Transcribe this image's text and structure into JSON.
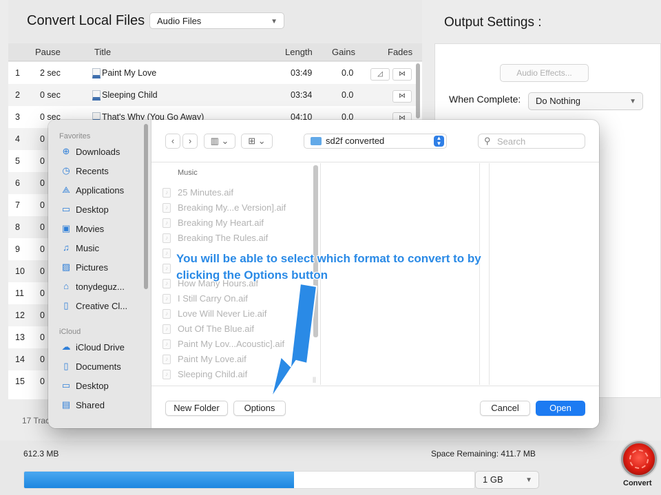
{
  "main": {
    "title": "Convert Local Files",
    "source_select": "Audio Files",
    "columns": {
      "pause": "Pause",
      "title": "Title",
      "length": "Length",
      "gains": "Gains",
      "fades": "Fades"
    },
    "tracks": [
      {
        "num": "1",
        "pause": "2 sec",
        "title": "Paint My Love",
        "length": "03:49",
        "gain": "0.0"
      },
      {
        "num": "2",
        "pause": "0 sec",
        "title": "Sleeping Child",
        "length": "03:34",
        "gain": "0.0"
      },
      {
        "num": "3",
        "pause": "0 sec",
        "title": "That's Why (You Go Away)",
        "length": "04:10",
        "gain": "0.0"
      },
      {
        "num": "4",
        "pause": "0"
      },
      {
        "num": "5",
        "pause": "0"
      },
      {
        "num": "6",
        "pause": "0"
      },
      {
        "num": "7",
        "pause": "0"
      },
      {
        "num": "8",
        "pause": "0"
      },
      {
        "num": "9",
        "pause": "0"
      },
      {
        "num": "10",
        "pause": "0"
      },
      {
        "num": "11",
        "pause": "0"
      },
      {
        "num": "12",
        "pause": "0"
      },
      {
        "num": "13",
        "pause": "0"
      },
      {
        "num": "14",
        "pause": "0"
      },
      {
        "num": "15",
        "pause": "0"
      }
    ],
    "track_count": "17 Trac"
  },
  "output": {
    "title": "Output Settings :",
    "audio_effects_button": "Audio Effects...",
    "when_complete_label": "When Complete:",
    "when_complete_value": "Do Nothing"
  },
  "status": {
    "total_size": "612.3 MB",
    "space_remaining": "Space Remaining: 411.7 MB",
    "capacity_select": "1 GB",
    "capacity_used_fraction": 0.6,
    "convert_label": "Convert"
  },
  "dialog": {
    "sidebar": {
      "favorites_header": "Favorites",
      "favorites": [
        {
          "label": "Downloads",
          "icon": "download-icon"
        },
        {
          "label": "Recents",
          "icon": "clock-icon"
        },
        {
          "label": "Applications",
          "icon": "applications-icon"
        },
        {
          "label": "Desktop",
          "icon": "desktop-icon"
        },
        {
          "label": "Movies",
          "icon": "film-icon"
        },
        {
          "label": "Music",
          "icon": "music-icon"
        },
        {
          "label": "Pictures",
          "icon": "pictures-icon"
        },
        {
          "label": "tonydeguz...",
          "icon": "home-icon"
        },
        {
          "label": "Creative Cl...",
          "icon": "document-icon"
        }
      ],
      "icloud_header": "iCloud",
      "icloud": [
        {
          "label": "iCloud Drive",
          "icon": "cloud-icon"
        },
        {
          "label": "Documents",
          "icon": "document-icon"
        },
        {
          "label": "Desktop",
          "icon": "desktop-icon"
        },
        {
          "label": "Shared",
          "icon": "shared-folder-icon"
        }
      ]
    },
    "location": "sd2f converted",
    "search_placeholder": "Search",
    "column_header": "Music",
    "files": [
      "25 Minutes.aif",
      "Breaking My...e Version].aif",
      "Breaking My Heart.aif",
      "Breaking The Rules.aif",
      "",
      "",
      "How Many Hours.aif",
      "I Still Carry On.aif",
      "Love Will Never Lie.aif",
      "Out Of The Blue.aif",
      "Paint My Lov...Acoustic].aif",
      "Paint My Love.aif",
      "Sleeping Child.aif"
    ],
    "buttons": {
      "new_folder": "New Folder",
      "options": "Options",
      "cancel": "Cancel",
      "open": "Open"
    }
  },
  "annotation": {
    "line1": "You will be able to select which format to convert to by",
    "line2": "clicking the Options button"
  },
  "colors": {
    "accent_blue": "#1d7bf2",
    "annotation_blue": "#2a8ae6",
    "convert_red": "#d81b10",
    "progress_blue": "#1e87e0"
  }
}
